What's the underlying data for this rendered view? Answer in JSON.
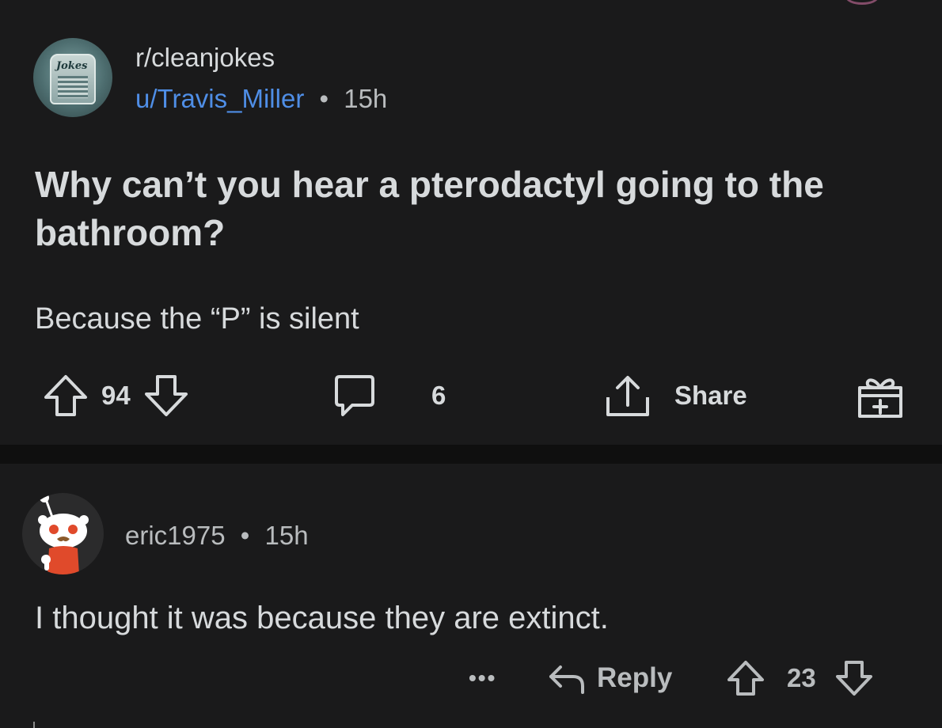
{
  "post": {
    "subreddit": "r/cleanjokes",
    "subreddit_avatar_text": "Jokes",
    "author": "u/Travis_Miller",
    "separator": "•",
    "age": "15h",
    "title": "Why can’t you hear a pterodactyl going to the bathroom?",
    "body": "Because the “P” is silent",
    "actions": {
      "upvote_icon": "upvote-arrow-icon",
      "score": "94",
      "downvote_icon": "downvote-arrow-icon",
      "comment_icon": "comment-bubble-icon",
      "comment_count": "6",
      "share_icon": "share-upload-icon",
      "share_label": "Share",
      "award_icon": "gift-award-icon"
    }
  },
  "comment": {
    "author": "eric1975",
    "separator": "•",
    "age": "15h",
    "body": "I thought it was because they are extinct.",
    "actions": {
      "more_label": "•••",
      "reply_icon": "reply-arrow-icon",
      "reply_label": "Reply",
      "score": "23"
    }
  },
  "colors": {
    "background": "#1a1a1b",
    "divider": "#0f0f0f",
    "text": "#d7dadc",
    "muted_text": "#b9bcbe",
    "username_link": "#4f8ee6",
    "snoo_shirt": "#e04a2b"
  }
}
